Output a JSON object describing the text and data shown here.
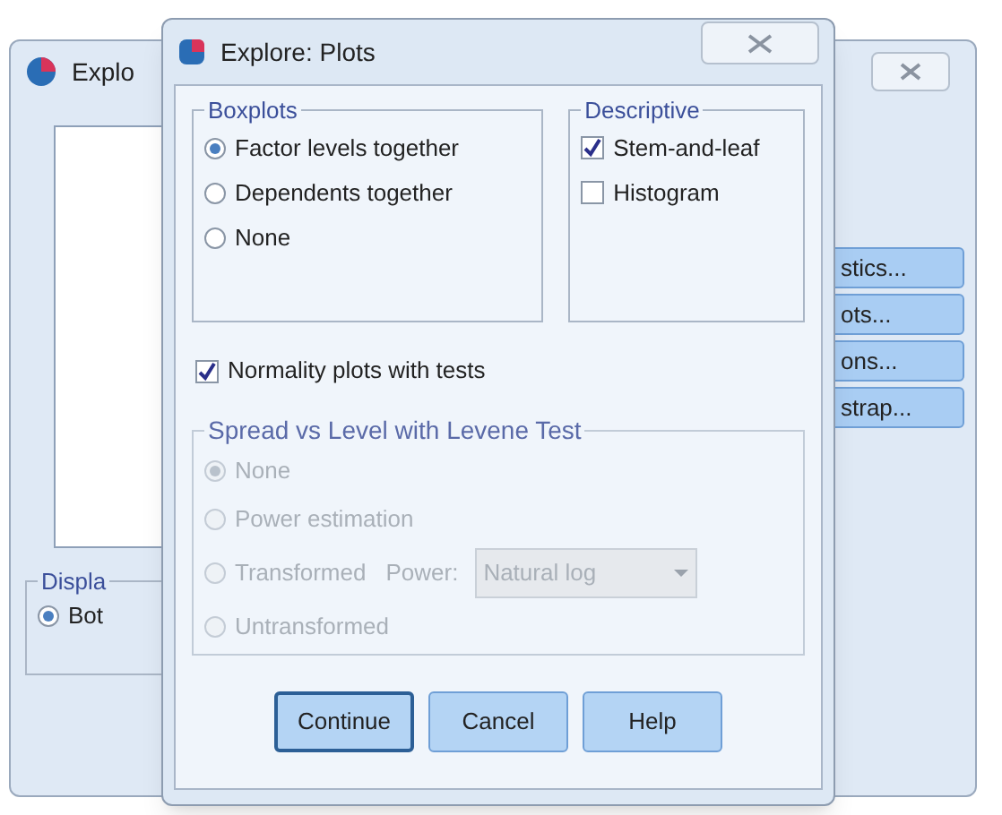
{
  "background_window": {
    "title": "Explo",
    "display_group": {
      "label": "Displa",
      "options": [
        {
          "label": "Bot",
          "selected": true
        }
      ]
    },
    "buttons": [
      "stics...",
      "ots...",
      "ons...",
      "strap..."
    ]
  },
  "dialog": {
    "title": "Explore: Plots",
    "boxplots": {
      "label": "Boxplots",
      "options": [
        {
          "label": "Factor levels together",
          "selected": true
        },
        {
          "label": "Dependents together",
          "selected": false
        },
        {
          "label": "None",
          "selected": false
        }
      ]
    },
    "descriptive": {
      "label": "Descriptive",
      "items": [
        {
          "label": "Stem-and-leaf",
          "checked": true
        },
        {
          "label": "Histogram",
          "checked": false
        }
      ]
    },
    "normality": {
      "label": "Normality plots with tests",
      "checked": true
    },
    "spread_vs_level": {
      "label": "Spread vs Level with Levene Test",
      "disabled": true,
      "options": [
        {
          "label": "None",
          "selected": true
        },
        {
          "label": "Power estimation",
          "selected": false
        },
        {
          "label": "Transformed",
          "selected": false
        },
        {
          "label": "Untransformed",
          "selected": false
        }
      ],
      "power": {
        "label": "Power:",
        "value": "Natural log"
      }
    },
    "buttons": [
      {
        "label": "Continue",
        "default": true
      },
      {
        "label": "Cancel",
        "default": false
      },
      {
        "label": "Help",
        "default": false
      }
    ]
  }
}
